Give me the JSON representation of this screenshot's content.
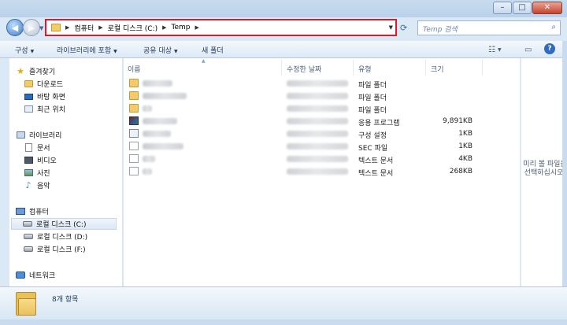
{
  "address": {
    "segments": [
      "컴퓨터",
      "로컬 디스크 (C:)",
      "Temp"
    ],
    "search_placeholder": "Temp 검색"
  },
  "toolbar": {
    "organize": "구성",
    "include_library": "라이브러리에 포함",
    "share_with": "공유 대상",
    "new_folder": "새 폴더"
  },
  "nav": {
    "favorites": {
      "label": "즐겨찾기",
      "items": [
        "다운로드",
        "바탕 화면",
        "최근 위치"
      ]
    },
    "libraries": {
      "label": "라이브러리",
      "items": [
        "문서",
        "비디오",
        "사진",
        "음악"
      ]
    },
    "computer": {
      "label": "컴퓨터",
      "items": [
        "로컬 디스크 (C:)",
        "로컬 디스크 (D:)",
        "로컬 디스크 (F:)"
      ],
      "selected": "로컬 디스크 (C:)"
    },
    "network": {
      "label": "네트워크"
    }
  },
  "columns": {
    "name": "이름",
    "modified": "수정한 날짜",
    "type": "유형",
    "size": "크기"
  },
  "files": [
    {
      "icon": "folder-icon",
      "type": "파일 폴더",
      "size": ""
    },
    {
      "icon": "folder-icon",
      "type": "파일 폴더",
      "size": ""
    },
    {
      "icon": "folder-icon",
      "type": "파일 폴더",
      "size": ""
    },
    {
      "icon": "installer-icon",
      "type": "응용 프로그램",
      "size": "9,891KB"
    },
    {
      "icon": "config-icon",
      "type": "구성 설정",
      "size": "1KB"
    },
    {
      "icon": "sec-file-icon",
      "type": "SEC 파일",
      "size": "1KB"
    },
    {
      "icon": "text-file-icon",
      "type": "텍스트 문서",
      "size": "4KB"
    },
    {
      "icon": "text-file-icon",
      "type": "텍스트 문서",
      "size": "268KB"
    }
  ],
  "preview": {
    "message": "미리 볼 파일을 선택하십시오."
  },
  "status": {
    "item_count": "8개 항목"
  },
  "colors": {
    "address_highlight": "#e0182c",
    "frame": "#c9dcef",
    "folder": "#f1cc6b"
  }
}
